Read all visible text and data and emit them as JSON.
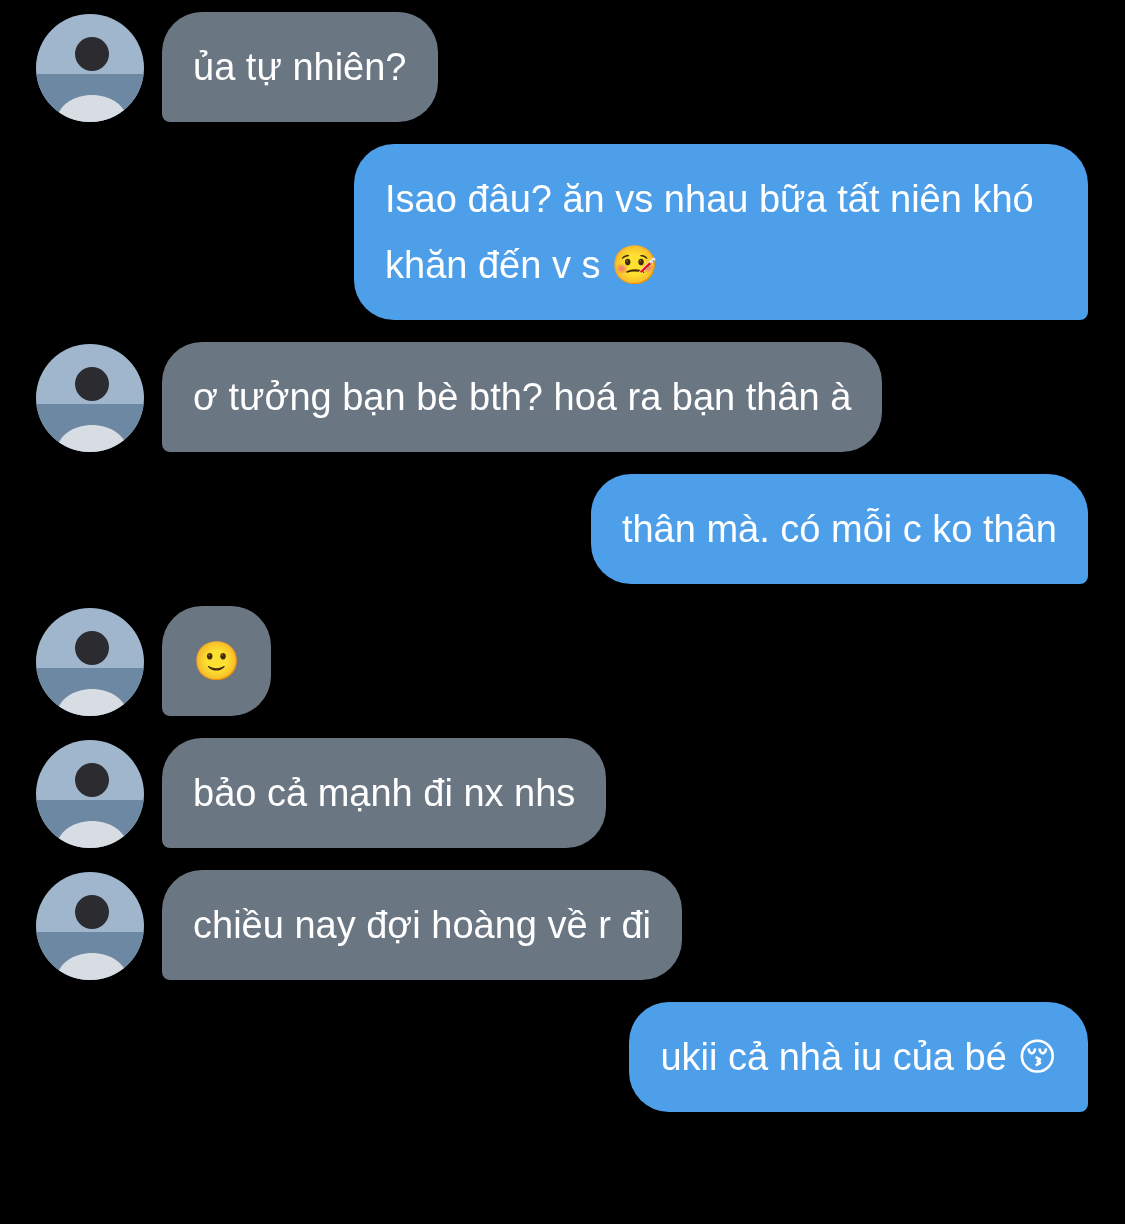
{
  "messages": [
    {
      "kind": "incoming",
      "text": "ủa tự nhiên?"
    },
    {
      "kind": "outgoing",
      "text": "Isao đâu? ăn vs nhau bữa tất niên khó khăn đến v s 🤒"
    },
    {
      "kind": "incoming",
      "text": "ơ tưởng bạn bè bth? hoá ra bạn thân à"
    },
    {
      "kind": "outgoing",
      "text": "thân mà. có mỗi c ko thân"
    },
    {
      "kind": "incoming",
      "text": "🙂"
    },
    {
      "kind": "incoming",
      "text": "bảo cả mạnh đi nx nhs"
    },
    {
      "kind": "incoming",
      "text": "chiều nay đợi hoàng về r đi"
    },
    {
      "kind": "outgoing",
      "text": "ukii cả nhà iu của bé 😚"
    }
  ]
}
